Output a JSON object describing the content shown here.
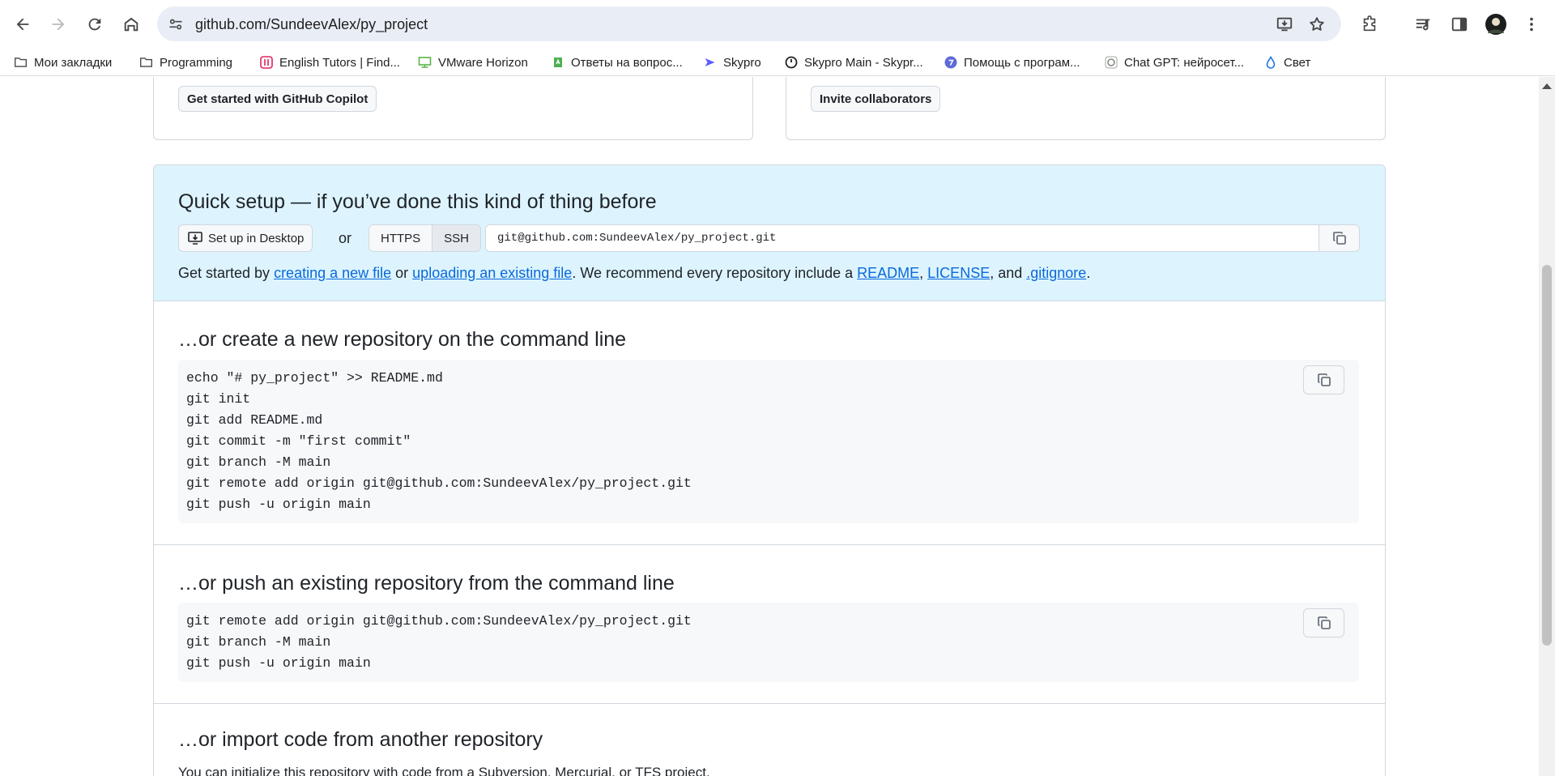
{
  "browser": {
    "url": "github.com/SundeevAlex/py_project",
    "bookmarks": [
      {
        "label": "Мои закладки",
        "icon": "folder-icon"
      },
      {
        "label": "Programming",
        "icon": "folder-icon"
      },
      {
        "label": "English Tutors | Find...",
        "icon": "tutors-favicon"
      },
      {
        "label": "VMware Horizon",
        "icon": "vmware-favicon"
      },
      {
        "label": "Ответы на вопрос...",
        "icon": "answers-favicon"
      },
      {
        "label": "Skypro",
        "icon": "skypro-favicon"
      },
      {
        "label": "Skypro Main - Skypr...",
        "icon": "skypro-main-favicon"
      },
      {
        "label": "Помощь с програм...",
        "icon": "help-favicon"
      },
      {
        "label": "Chat GPT: нейросет...",
        "icon": "chatgpt-favicon"
      },
      {
        "label": "Свет",
        "icon": "drop-favicon"
      }
    ]
  },
  "top_cards": {
    "copilot_button": "Get started with GitHub Copilot",
    "invite_button": "Invite collaborators"
  },
  "quick_setup": {
    "title": "Quick setup — if you’ve done this kind of thing before",
    "desktop_button": "Set up in Desktop",
    "or": "or",
    "protocols": [
      "HTTPS",
      "SSH"
    ],
    "selected_protocol": "SSH",
    "clone_url": "git@github.com:SundeevAlex/py_project.git",
    "hint": {
      "prefix": "Get started by ",
      "link_new_file": "creating a new file",
      "or": " or ",
      "link_upload": "uploading an existing file",
      "middle": ". We recommend every repository include a ",
      "link_readme": "README",
      "comma1": ", ",
      "link_license": "LICENSE",
      "and": ", and ",
      "link_gitignore": ".gitignore",
      "end": "."
    }
  },
  "create_section": {
    "title": "…or create a new repository on the command line",
    "lines": [
      "echo \"# py_project\" >> README.md",
      "git init",
      "git add README.md",
      "git commit -m \"first commit\"",
      "git branch -M main",
      "git remote add origin git@github.com:SundeevAlex/py_project.git",
      "git push -u origin main"
    ]
  },
  "push_section": {
    "title": "…or push an existing repository from the command line",
    "lines": [
      "git remote add origin git@github.com:SundeevAlex/py_project.git",
      "git branch -M main",
      "git push -u origin main"
    ]
  },
  "import_section": {
    "title": "…or import code from another repository",
    "description": "You can initialize this repository with code from a Subversion, Mercurial, or TFS project."
  }
}
